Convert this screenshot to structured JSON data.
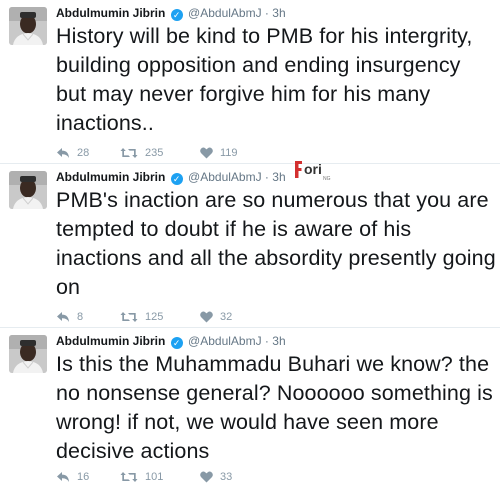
{
  "tweets": [
    {
      "name": "Abdulmumin Jibrin",
      "handle": "@AbdulAbmJ",
      "separator": "·",
      "time": "3h",
      "text": "History will be kind to PMB for his intergrity, building opposition and ending insurgency but may never forgive him for his many inactions..",
      "replies": "28",
      "retweets": "235",
      "likes": "119"
    },
    {
      "name": "Abdulmumin Jibrin",
      "handle": "@AbdulAbmJ",
      "separator": "·",
      "time": "3h",
      "text": "PMB's inaction are so numerous that you are tempted to doubt if he is aware of his inactions and all the absordity presently going on",
      "replies": "8",
      "retweets": "125",
      "likes": "32"
    },
    {
      "name": "Abdulmumin Jibrin",
      "handle": "@AbdulAbmJ",
      "separator": "·",
      "time": "3h",
      "text": "Is this the Muhammadu Buhari we know? the no nonsense general? Noooooo something is wrong!  if not, we would have seen more decisive actions",
      "replies": "16",
      "retweets": "101",
      "likes": "33"
    }
  ],
  "watermark": {
    "text": "ori",
    "sub": "NG"
  },
  "icons": {
    "verified": "verified-badge-icon",
    "reply": "reply-icon",
    "retweet": "retweet-icon",
    "like": "heart-icon"
  },
  "colors": {
    "verified": "#1da1f2",
    "muted": "#657786",
    "icon": "#8899a6",
    "watermark_red": "#d32f2f"
  }
}
